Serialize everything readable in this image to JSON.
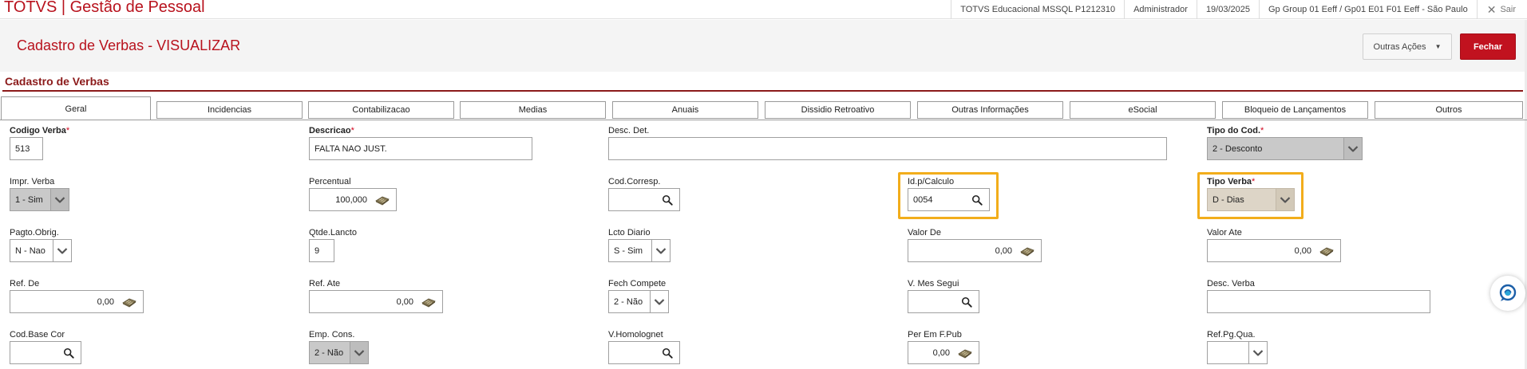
{
  "app": {
    "title": "TOTVS | Gestão de Pessoal"
  },
  "topbar": {
    "environment": "TOTVS Educacional MSSQL P1212310",
    "user": "Administrador",
    "date": "19/03/2025",
    "company": "Gp Group 01 Eeff / Gp01 E01 F01 Eeff - São Paulo",
    "exit_label": "Sair"
  },
  "header": {
    "page_title": "Cadastro de Verbas - VISUALIZAR",
    "actions_label": "Outras Ações",
    "close_label": "Fechar"
  },
  "section": {
    "title": "Cadastro de Verbas"
  },
  "tabs": [
    {
      "label": "Geral"
    },
    {
      "label": "Incidencias"
    },
    {
      "label": "Contabilizacao"
    },
    {
      "label": "Medias"
    },
    {
      "label": "Anuais"
    },
    {
      "label": "Dissidio Retroativo"
    },
    {
      "label": "Outras Informações"
    },
    {
      "label": "eSocial"
    },
    {
      "label": "Bloqueio de Lançamentos"
    },
    {
      "label": "Outros"
    }
  ],
  "fields": {
    "codigo_verba": {
      "label": "Codigo Verba",
      "value": "513"
    },
    "descricao": {
      "label": "Descricao",
      "value": "FALTA NAO JUST."
    },
    "desc_det": {
      "label": "Desc. Det.",
      "value": ""
    },
    "tipo_cod": {
      "label": "Tipo do Cod.",
      "value": "2 - Desconto"
    },
    "impr_verba": {
      "label": "Impr. Verba",
      "value": "1 - Sim"
    },
    "percentual": {
      "label": "Percentual",
      "value": "100,000"
    },
    "cod_corresp": {
      "label": "Cod.Corresp.",
      "value": ""
    },
    "id_calculo": {
      "label": "Id.p/Calculo",
      "value": "0054"
    },
    "tipo_verba": {
      "label": "Tipo Verba",
      "value": "D - Dias"
    },
    "pagto_obrig": {
      "label": "Pagto.Obrig.",
      "value": "N - Nao"
    },
    "qtde_lancto": {
      "label": "Qtde.Lancto",
      "value": "9"
    },
    "lcto_diario": {
      "label": "Lcto Diario",
      "value": "S - Sim"
    },
    "valor_de": {
      "label": "Valor De",
      "value": "0,00"
    },
    "valor_ate": {
      "label": "Valor Ate",
      "value": "0,00"
    },
    "ref_de": {
      "label": "Ref. De",
      "value": "0,00"
    },
    "ref_ate": {
      "label": "Ref. Ate",
      "value": "0,00"
    },
    "fech_compete": {
      "label": "Fech Compete",
      "value": "2 - Não"
    },
    "v_mes_segui": {
      "label": "V. Mes Segui",
      "value": ""
    },
    "desc_verba": {
      "label": "Desc. Verba",
      "value": ""
    },
    "cod_base_cor": {
      "label": "Cod.Base Cor",
      "value": ""
    },
    "emp_cons": {
      "label": "Emp. Cons.",
      "value": "2 - Não"
    },
    "v_homolognet": {
      "label": "V.Homolognet",
      "value": ""
    },
    "per_em_fpub": {
      "label": "Per Em F.Pub",
      "value": "0,00"
    },
    "ref_pg_qua": {
      "label": "Ref.Pg.Qua.",
      "value": ""
    }
  },
  "colors": {
    "brand": "#b8121d",
    "highlight": "#f2ad1b",
    "close_button": "#c1121f"
  },
  "icons": [
    "search-icon",
    "calculator-icon",
    "chevron-down-icon",
    "close-icon",
    "chat-icon"
  ]
}
